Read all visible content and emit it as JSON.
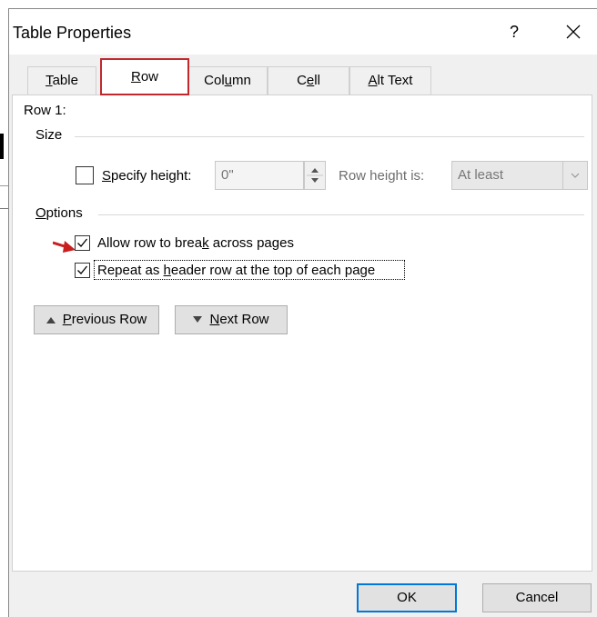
{
  "dialog": {
    "title": "Table Properties",
    "help_label": "?",
    "close_icon": "close-icon"
  },
  "tabs": [
    {
      "label_pre": "",
      "label_u": "T",
      "label_post": "able",
      "active": false
    },
    {
      "label_pre": "",
      "label_u": "R",
      "label_post": "ow",
      "active": true
    },
    {
      "label_pre": "Col",
      "label_u": "u",
      "label_post": "mn",
      "active": false
    },
    {
      "label_pre": "C",
      "label_u": "e",
      "label_post": "ll",
      "active": false
    },
    {
      "label_pre": "",
      "label_u": "A",
      "label_post": "lt Text",
      "active": false
    }
  ],
  "row_panel": {
    "row_label": "Row 1:",
    "size_group": "Size",
    "specify_height": {
      "pre": "",
      "u": "S",
      "post": "pecify height:",
      "checked": false
    },
    "height_value": "0\"",
    "row_height_is_label": "Row height is:",
    "row_height_mode": "At least",
    "options_group_u": "O",
    "options_group_post": "ptions",
    "allow_break": {
      "pre": "Allow row to brea",
      "u": "k",
      "post": " across pages",
      "checked": true
    },
    "repeat_header": {
      "pre": "Repeat as ",
      "u": "h",
      "post": "eader row at the top of each page",
      "checked": true
    },
    "previous_row": {
      "pre": "",
      "u": "P",
      "post": "revious Row"
    },
    "next_row": {
      "pre": "",
      "u": "N",
      "post": "ext Row"
    }
  },
  "footer": {
    "ok_label": "OK",
    "cancel_label": "Cancel"
  },
  "colors": {
    "highlight_red": "#c0282d",
    "arrow_red": "#c81e1e",
    "primary_blue": "#0078d7"
  }
}
